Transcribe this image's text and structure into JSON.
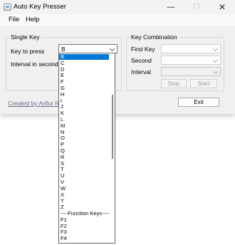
{
  "window": {
    "title": "Auto Key Presser"
  },
  "title_buttons": {
    "minimize": "—",
    "maximize": "☐",
    "close": "✕"
  },
  "menu": {
    "file": "File",
    "help": "Help"
  },
  "single_key": {
    "group_title": "Single Key",
    "key_label": "Key to press",
    "key_value": "B",
    "interval_label": "Interval in seconds"
  },
  "combo": {
    "group_title": "Key Combination",
    "first_label": "First Key",
    "second_label": "Second",
    "interval_label": "Interval",
    "stop": "Stop",
    "start": "Start"
  },
  "exit": "Exit",
  "credit": "Created by Arifur Rahm",
  "dropdown": {
    "selected": "B",
    "items": [
      "B",
      "C",
      "D",
      "E",
      "F",
      "G",
      "H",
      "I",
      "J",
      "K",
      "L",
      "M",
      "N",
      "O",
      "P",
      "Q",
      "R",
      "S",
      "T",
      "U",
      "V",
      "W",
      "X",
      "Y",
      "Z",
      "----Function Keys----",
      "F1",
      "F2",
      "F3",
      "F4"
    ]
  }
}
